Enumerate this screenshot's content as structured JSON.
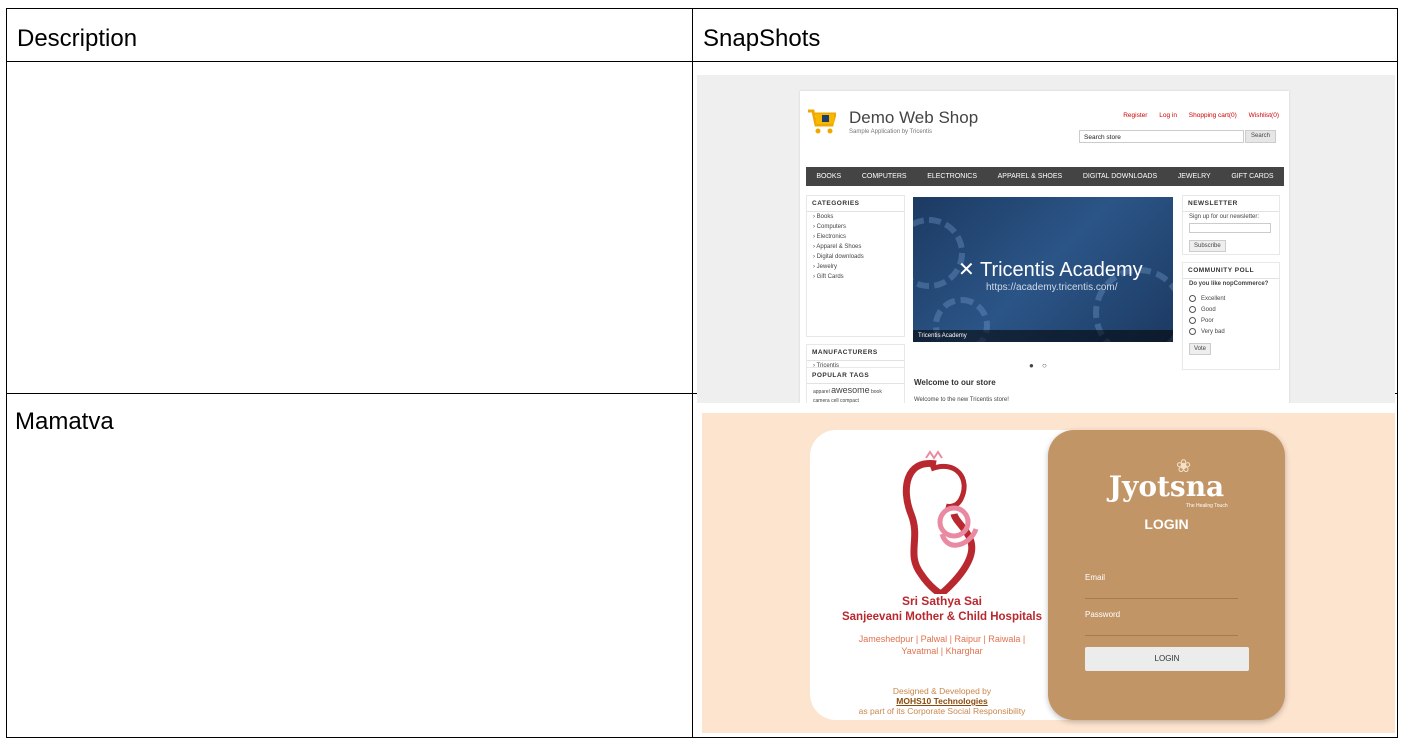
{
  "table": {
    "headers": {
      "description": "Description",
      "snapshots": "SnapShots"
    },
    "rows": [
      {
        "description": ""
      },
      {
        "description": "Mamatva"
      }
    ]
  },
  "demo_shop": {
    "logo_title": "Demo Web Shop",
    "logo_subtitle": "Sample Application by Tricentis",
    "top_links": [
      "Register",
      "Log in",
      "Shopping cart(0)",
      "Wishlist(0)"
    ],
    "search_placeholder": "Search store",
    "search_button": "Search",
    "menu": [
      "BOOKS",
      "COMPUTERS",
      "ELECTRONICS",
      "APPAREL & SHOES",
      "DIGITAL DOWNLOADS",
      "JEWELRY",
      "GIFT CARDS"
    ],
    "categories_title": "CATEGORIES",
    "categories": [
      "Books",
      "Computers",
      "Electronics",
      "Apparel & Shoes",
      "Digital downloads",
      "Jewelry",
      "Gift Cards"
    ],
    "manufacturers_title": "MANUFACTURERS",
    "manufacturers": [
      "Tricentis"
    ],
    "tags_title": "POPULAR TAGS",
    "tags": [
      "apparel",
      "awesome",
      "book",
      "camera",
      "cell",
      "compact"
    ],
    "banner_title": "Tricentis Academy",
    "banner_url": "https://academy.tricentis.com/",
    "banner_caption": "Tricentis Academy",
    "welcome_title": "Welcome to our store",
    "welcome_text": "Welcome to the new Tricentis store!",
    "newsletter_title": "NEWSLETTER",
    "newsletter_label": "Sign up for our newsletter:",
    "subscribe_button": "Subscribe",
    "poll_title": "COMMUNITY POLL",
    "poll_question": "Do you like nopCommerce?",
    "poll_options": [
      "Excellent",
      "Good",
      "Poor",
      "Very bad"
    ],
    "vote_button": "Vote"
  },
  "mamatva": {
    "hospital_line1": "Sri Sathya Sai",
    "hospital_line2": "Sanjeevani Mother & Child Hospitals",
    "places_line1": "Jameshedpur | Palwal | Raipur | Raiwala |",
    "places_line2": "Yavatmal | Kharghar",
    "credit_line1": "Designed & Developed by",
    "credit_company": "MOHS10 Technologies",
    "credit_line3": "as part of its Corporate Social Responsibility",
    "brand": "Jyotsna",
    "brand_tagline": "The Healing Touch",
    "login_heading": "LOGIN",
    "email_label": "Email",
    "password_label": "Password",
    "login_button": "LOGIN"
  },
  "colors": {
    "hospital_red": "#b8282e",
    "login_panel": "#c29566",
    "page_peach": "#fde4cf",
    "shop_menu": "#444444"
  }
}
